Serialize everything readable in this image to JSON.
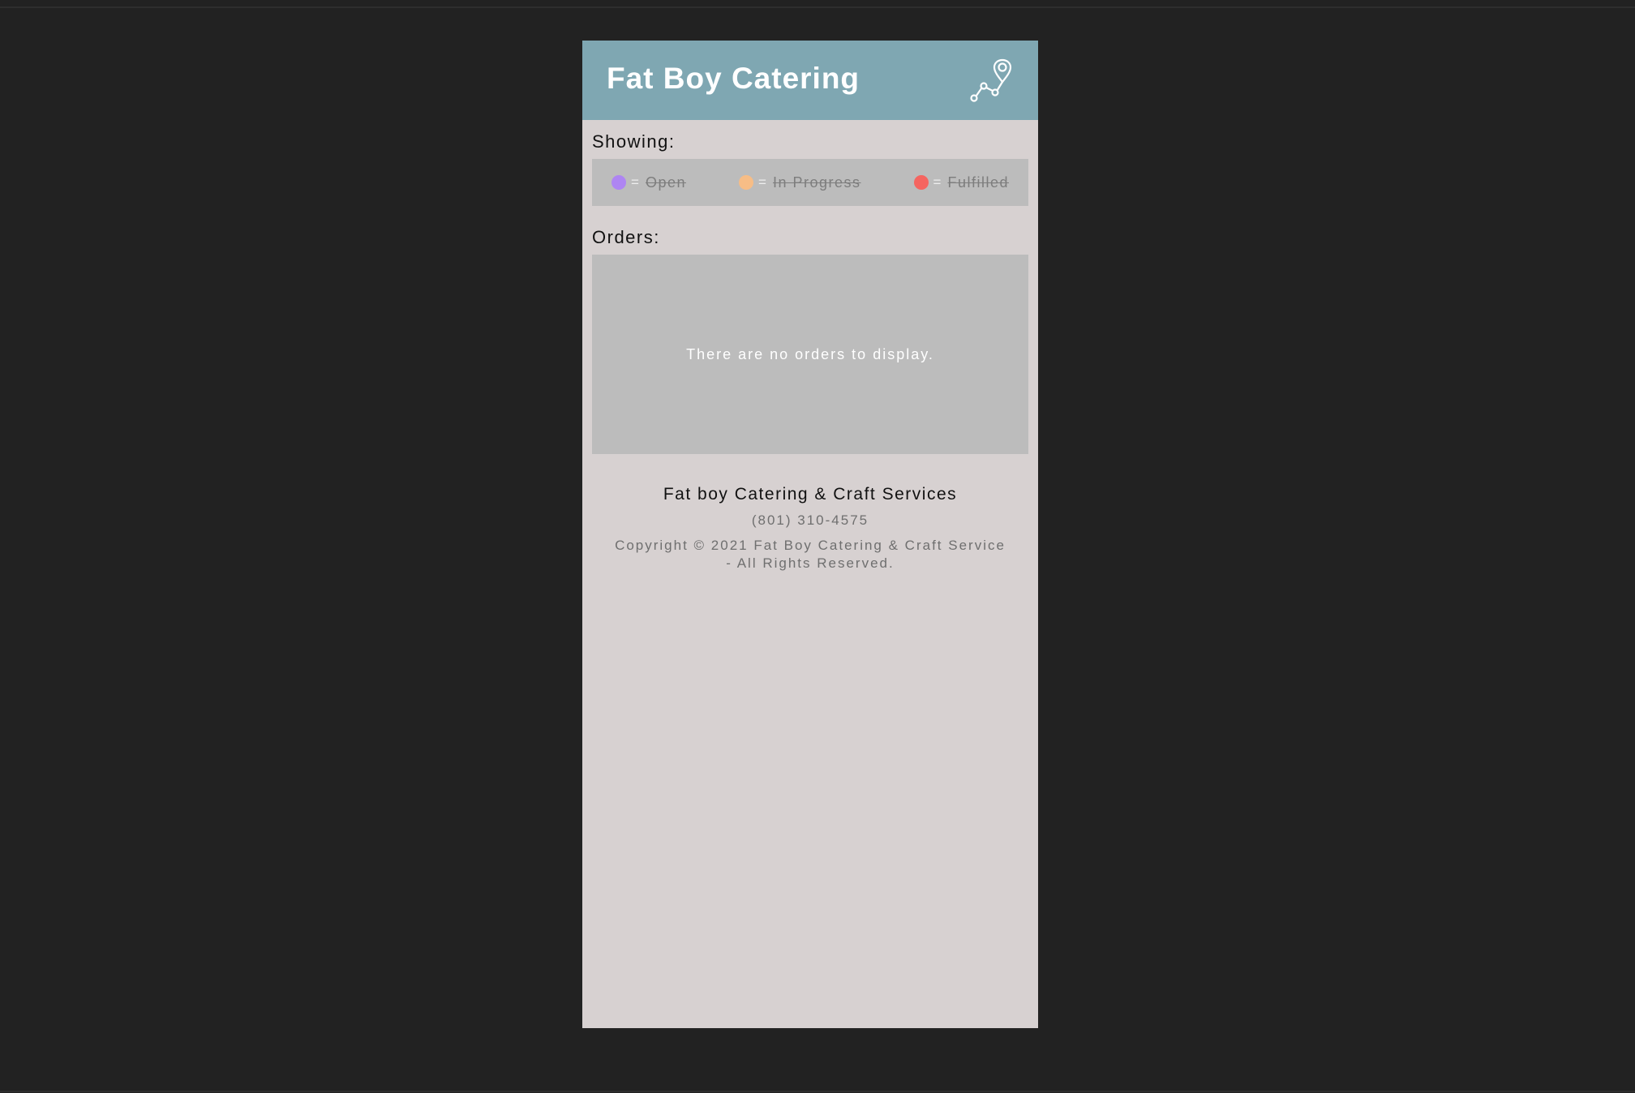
{
  "header": {
    "title": "Fat Boy Catering",
    "icon": "route-icon"
  },
  "filters": {
    "label": "Showing:",
    "items": [
      {
        "label": "Open",
        "separator": "=",
        "color": "#ae85f2",
        "icon": "status-dot-open-icon"
      },
      {
        "label": "In Progress",
        "separator": "=",
        "color": "#f7bd86",
        "icon": "status-dot-in-progress-icon"
      },
      {
        "label": "Fulfilled",
        "separator": "=",
        "color": "#f56560",
        "icon": "status-dot-fulfilled-icon"
      }
    ]
  },
  "orders": {
    "label": "Orders:",
    "empty_message": "There are no orders to display."
  },
  "footer": {
    "company": "Fat boy Catering & Craft Services",
    "phone": "(801) 310-4575",
    "copyright_line1": "Copyright © 2021 Fat Boy Catering & Craft Service",
    "copyright_line2": "- All Rights Reserved."
  },
  "colors": {
    "header_bg": "#7fa7b2",
    "page_bg": "#d7d1d1",
    "panel_bg": "#bcbcbc",
    "outer_bg": "#222222"
  }
}
